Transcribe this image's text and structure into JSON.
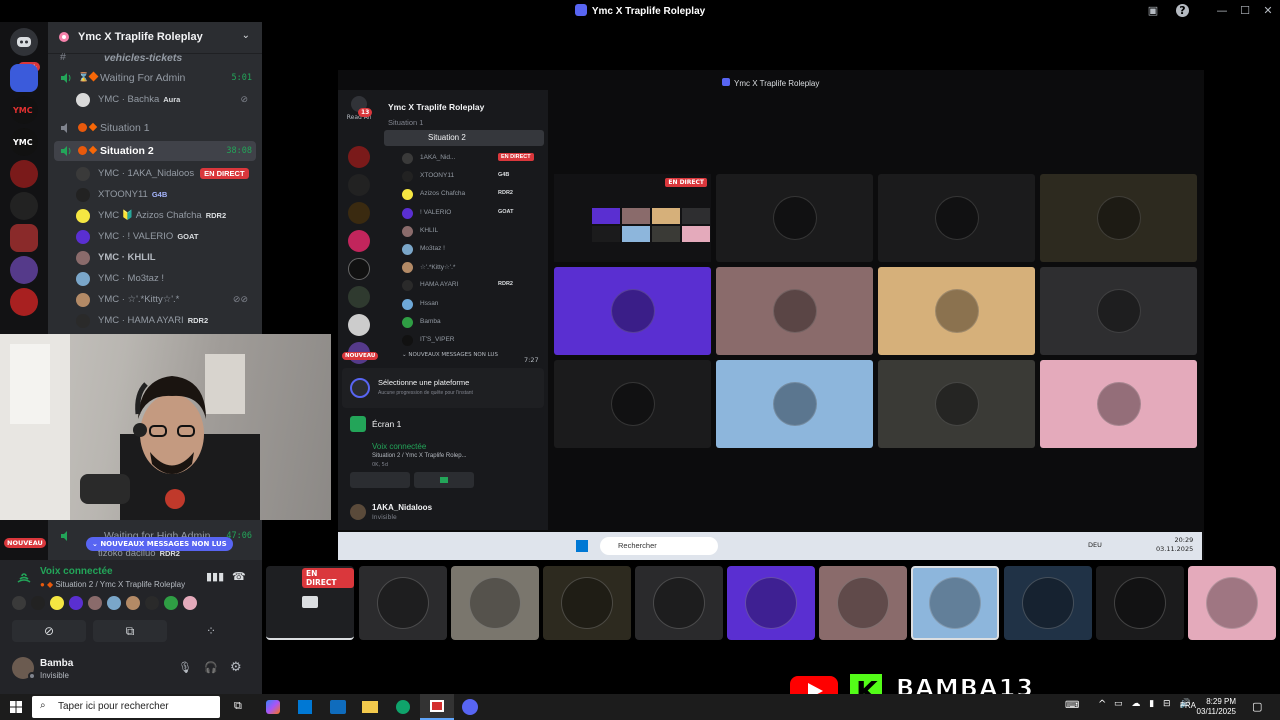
{
  "window": {
    "title": "Ymc X Traplife Roleplay"
  },
  "rail": {
    "badge_top": "1K+",
    "badge_new": "NOUVEAU"
  },
  "sidebar": {
    "guild_name": "Ymc X Traplife Roleplay",
    "partial_channel": "vehicles-tickets",
    "channels": [
      {
        "label": "Waiting For Admin",
        "time": "5:01"
      },
      {
        "label": "Situation 1",
        "time": ""
      },
      {
        "label": "Situation 2",
        "time": "38:08"
      },
      {
        "label": "Waiting for High Admin",
        "time": "47:06"
      }
    ],
    "users_waiting": [
      {
        "name": "YMC · Bachka",
        "tag": "Aura"
      }
    ],
    "users_sit2": [
      {
        "name": "YMC · 1AKA_Nidaloos",
        "tag": "",
        "live": "EN DIRECT"
      },
      {
        "name": "XTOONY11",
        "tag": "G4B"
      },
      {
        "name": "YMC 🔰 Azizos Chafcha",
        "tag": "RDR2"
      },
      {
        "name": "YMC · ! VALERIO",
        "tag": "GOAT"
      },
      {
        "name": "YMC · KHLIL",
        "tag": ""
      },
      {
        "name": "YMC · Mo3taz !",
        "tag": ""
      },
      {
        "name": "YMC · ☆'.*Kitty☆'.*",
        "tag": ""
      },
      {
        "name": "YMC · HAMA AYARI",
        "tag": "RDR2"
      }
    ],
    "unread_banner": "NOUVEAUX MESSAGES NON LUS",
    "partial_user": "tizoko daciluo",
    "partial_user_tag": "RDR2"
  },
  "voice": {
    "status": "Voix connectée",
    "channel": "Situation 2 / Ymc X Traplife Roleplay"
  },
  "user": {
    "name": "Bamba",
    "status": "Invisible"
  },
  "inner": {
    "title": "Ymc X Traplife Roleplay",
    "rail_label": "Read All",
    "rail_badge": "13",
    "rail_new": "NOUVEAU",
    "guild_name": "Ymc X Traplife Roleplay",
    "channels": [
      "Situation 1",
      "Situation 2"
    ],
    "users": [
      {
        "name": "1AKA_Nid...",
        "live": "EN DIRECT"
      },
      {
        "name": "XTOONY11",
        "tag": "G4B"
      },
      {
        "name": "Azizos Chafcha",
        "tag": "RDR2"
      },
      {
        "name": "! VALERIO",
        "tag": "GOAT"
      },
      {
        "name": "KHLIL"
      },
      {
        "name": "Mo3taz !"
      },
      {
        "name": "☆'.*Kitty☆'.*"
      },
      {
        "name": "HAMA AYARI",
        "tag": "RDR2"
      },
      {
        "name": "Hssan"
      },
      {
        "name": "Bamba"
      },
      {
        "name": "IT'S_VIPER"
      }
    ],
    "unread": "NOUVEAUX MESSAGES NON LUS",
    "unread_time": "7:27",
    "platform_title": "Sélectionne une plateforme",
    "platform_sub": "Aucune progression de quête pour l'instant",
    "screen_label": "Écran 1",
    "voice_status": "Voix connectée",
    "voice_channel": "Situation 2 / Ymc X Traplife Rolep...",
    "voice_sub": "0K, 5d",
    "user_name": "1AKA_Nidaloos",
    "user_status": "Invisible",
    "live_label": "EN DIRECT",
    "taskbar_search": "Rechercher",
    "taskbar_lang": "DEU",
    "taskbar_time": "20:29",
    "taskbar_date": "03.11.2025",
    "tile_colors": [
      "#1b1b1c",
      "#1b1b1c",
      "#2d2a1f",
      "#5a2fd1",
      "#8a6b6b",
      "#d6b07a",
      "#2e2e30",
      "#1b1b1c",
      "#8db6dc",
      "#3a3a36",
      "#e4aabb"
    ]
  },
  "strip": {
    "live_label": "EN DIRECT",
    "tile_colors": [
      "#2b2b2d",
      "#7a766d",
      "#2d2a1f",
      "#2a2a2c",
      "#5a2fd1",
      "#8a6b6b",
      "#8db6dc",
      "#203246",
      "#1b1b1c",
      "#e4aabb"
    ]
  },
  "taskbar": {
    "search_placeholder": "Taper ici pour rechercher",
    "lang": "FRA",
    "time": "8:29 PM",
    "date": "03/11/2025"
  },
  "brand": {
    "name": "BAMBA13"
  },
  "colors": {
    "live_red": "#da373c",
    "green": "#23a559",
    "blurple": "#5865f2"
  }
}
